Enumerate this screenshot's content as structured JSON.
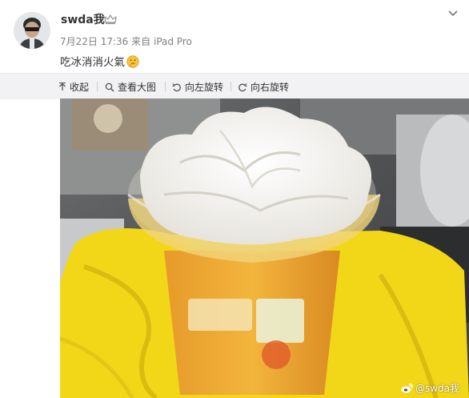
{
  "post": {
    "username": "swda我",
    "date": "7月22日 17:36",
    "source_prefix": "来自",
    "source": "iPad Pro",
    "text": "吃冰消消火氣"
  },
  "media_toolbar": {
    "collapse_label": "收起",
    "view_large_label": "查看大图",
    "rotate_left_label": "向左旋转",
    "rotate_right_label": "向右旋转"
  },
  "photo": {
    "watermark": "@swda我"
  },
  "icons": {
    "emoji": "thinking-face-icon",
    "badge": "vip-crown-icon",
    "menu": "chevron-down-icon"
  },
  "colors": {
    "username": "#333333",
    "meta": "#808080",
    "toolbar_bg": "#f2f2f5",
    "towel": "#f2d718",
    "cream": "#f7f6f2"
  }
}
